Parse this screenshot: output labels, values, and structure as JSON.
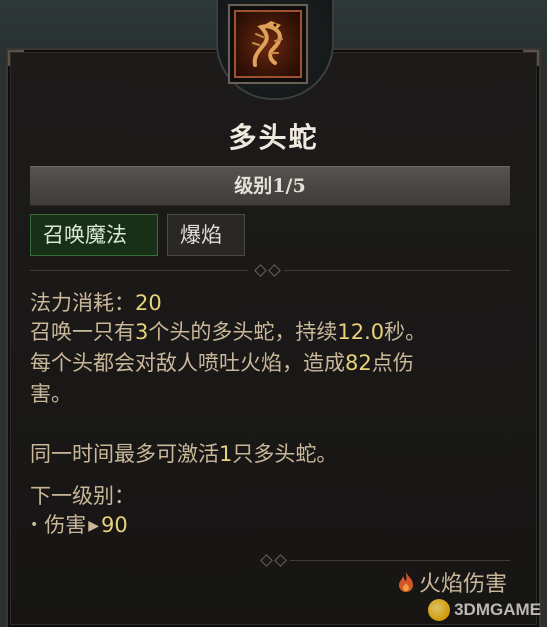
{
  "skill": {
    "name": "多头蛇",
    "rank_label": "级别1/5",
    "tags": [
      "召唤魔法",
      "爆焰"
    ],
    "icon": "hydra-icon"
  },
  "description": {
    "cost_label": "法力消耗：",
    "cost_value": "20",
    "line1_a": "召唤一只有",
    "heads": "3",
    "line1_b": "个头的多头蛇，持续",
    "duration": "12.0",
    "line1_c": "秒。",
    "line2": "每个头都会对敌人喷吐火焰，造成",
    "damage": "82",
    "line2_b": "点伤",
    "line3": "害。",
    "limit_a": "同一时间最多可激活",
    "limit_count": "1",
    "limit_b": "只多头蛇。",
    "next_rank_label": "下一级别：",
    "next_stat_label": "伤害",
    "next_stat_value": "90"
  },
  "damage_type": {
    "label": "火焰伤害",
    "icon": "flame-icon"
  },
  "watermark": {
    "text": "3DMGAME"
  },
  "colors": {
    "highlight_number": "#e6d27a",
    "body_text": "#c9b79a",
    "summon_tag_bg": "#183018"
  }
}
